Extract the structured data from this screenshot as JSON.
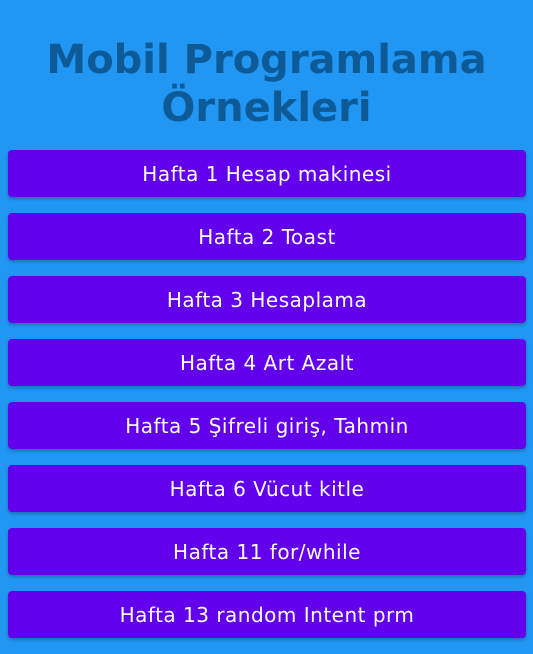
{
  "header": {
    "title_line1": "Mobil Programlama",
    "title_line2": "Örnekleri"
  },
  "buttons": [
    {
      "label": "Hafta 1 Hesap makinesi"
    },
    {
      "label": "Hafta 2 Toast"
    },
    {
      "label": "Hafta 3 Hesaplama"
    },
    {
      "label": "Hafta 4 Art Azalt"
    },
    {
      "label": "Hafta 5 Şifreli giriş, Tahmin"
    },
    {
      "label": "Hafta 6 Vücut kitle"
    },
    {
      "label": "Hafta 11 for/while"
    },
    {
      "label": "Hafta 13 random Intent prm"
    }
  ],
  "colors": {
    "background": "#2196F3",
    "title": "#0D5A96",
    "button": "#6200EE",
    "button_text": "#FFFFFF"
  }
}
